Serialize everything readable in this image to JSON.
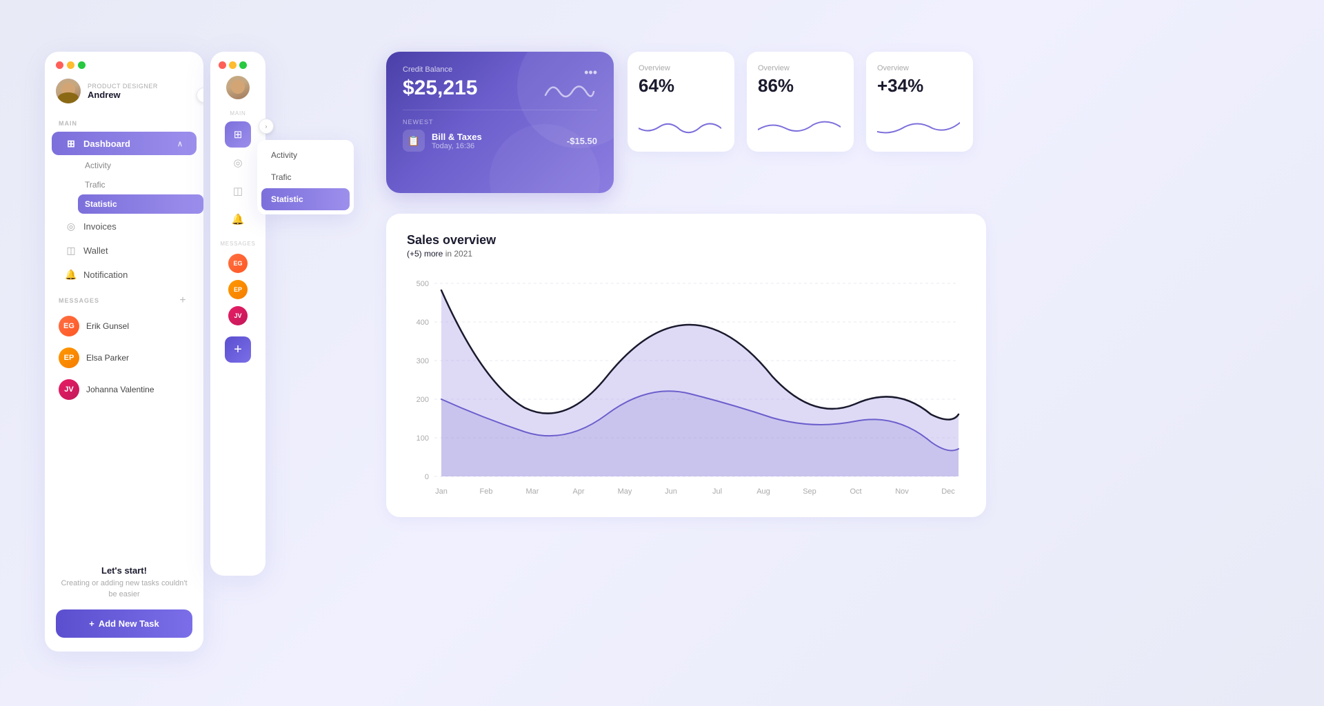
{
  "sidebar1": {
    "window_dots": [
      "red",
      "yellow",
      "green"
    ],
    "user": {
      "role": "Product Designer",
      "name": "Andrew"
    },
    "sections": {
      "main_label": "MAIN",
      "nav_items": [
        {
          "id": "dashboard",
          "label": "Dashboard",
          "icon": "⊞",
          "active": true
        },
        {
          "id": "activity",
          "label": "Activity",
          "sub": true
        },
        {
          "id": "trafic",
          "label": "Trafic",
          "sub": true
        },
        {
          "id": "statistic",
          "label": "Statistic",
          "sub": true,
          "active2": true
        },
        {
          "id": "invoices",
          "label": "Invoices",
          "icon": "◎"
        },
        {
          "id": "wallet",
          "label": "Wallet",
          "icon": "◫"
        },
        {
          "id": "notification",
          "label": "Notification",
          "icon": "🔔"
        }
      ],
      "messages_label": "MESSAGES",
      "messages": [
        {
          "name": "Erik Gunsel"
        },
        {
          "name": "Elsa Parker"
        },
        {
          "name": "Johanna Valentine"
        }
      ]
    },
    "bottom": {
      "title": "Let's start!",
      "desc": "Creating or adding new tasks couldn't be easier",
      "btn_label": "Add New Task"
    }
  },
  "sidebar2": {
    "dropdown": {
      "items": [
        {
          "label": "Activity"
        },
        {
          "label": "Trafic"
        },
        {
          "label": "Statistic",
          "active": true
        }
      ]
    }
  },
  "credit_card": {
    "label": "Credit Balance",
    "balance": "$25,215",
    "more_icon": "•••",
    "newest_label": "NEWEST",
    "transaction": {
      "name": "Bill & Taxes",
      "date": "Today, 16:36",
      "amount": "-$15.50"
    }
  },
  "overview_cards": [
    {
      "label": "Overview",
      "value": "64%"
    },
    {
      "label": "Overview",
      "value": "86%"
    },
    {
      "label": "Overview",
      "value": "+34%"
    }
  ],
  "sales_chart": {
    "title": "Sales overview",
    "subtitle_highlight": "(+5) more",
    "subtitle_rest": " in 2021",
    "y_labels": [
      "500",
      "400",
      "300",
      "200",
      "100",
      "0"
    ],
    "x_labels": [
      "Jan",
      "Feb",
      "Mar",
      "Apr",
      "May",
      "Jun",
      "Jul",
      "Aug",
      "Sep",
      "Oct",
      "Nov",
      "Dec"
    ]
  }
}
